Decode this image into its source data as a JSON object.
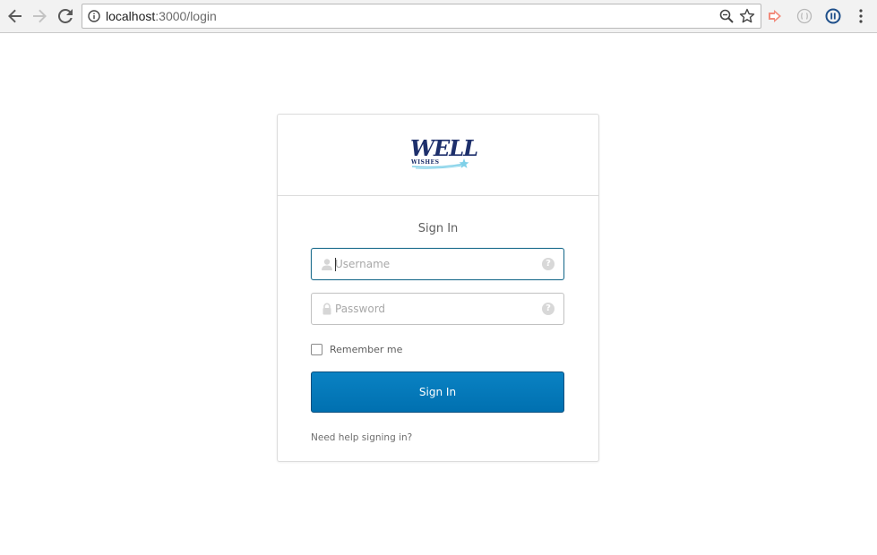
{
  "browser": {
    "url_host": "localhost",
    "url_path": ":3000/login",
    "icons": {
      "back": "arrow-left-icon",
      "forward": "arrow-right-icon",
      "reload": "reload-icon",
      "site_info": "info-icon",
      "zoom": "zoom-icon",
      "bookmark": "star-icon",
      "extension_1": "extension-arrow-icon",
      "extension_2": "extension-circle-icon",
      "extension_3": "extension-pause-icon",
      "menu": "kebab-menu-icon"
    }
  },
  "login": {
    "logo_text": "WELL",
    "logo_subtext": "WISHES",
    "title": "Sign In",
    "username": {
      "placeholder": "Username",
      "value": "",
      "help_glyph": "?"
    },
    "password": {
      "placeholder": "Password",
      "value": "",
      "help_glyph": "?"
    },
    "remember_label": "Remember me",
    "remember_checked": false,
    "submit_label": "Sign In",
    "help_link": "Need help signing in?"
  },
  "colors": {
    "brand_navy": "#1d2f6b",
    "button_blue": "#0078bf",
    "focus_border": "#1f6f8f"
  }
}
